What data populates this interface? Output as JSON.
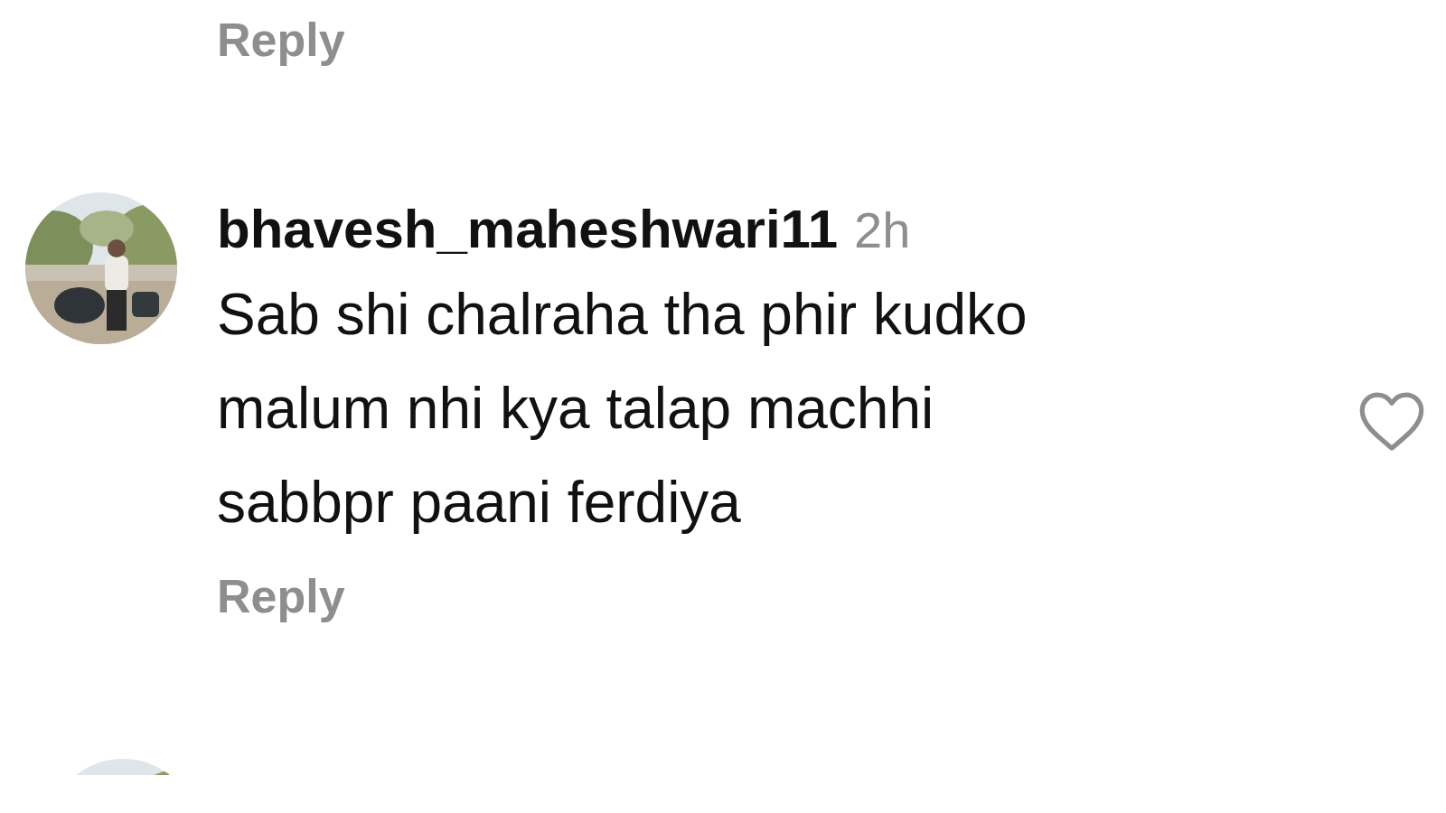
{
  "previous_comment": {
    "reply": "Reply"
  },
  "comment": {
    "username": "bhavesh_maheshwari11",
    "time": "2h",
    "text": "Sab shi chalraha tha phir kudko\nmalum nhi kya talap machhi\nsabbpr paani ferdiya",
    "reply": "Reply",
    "liked": false
  }
}
